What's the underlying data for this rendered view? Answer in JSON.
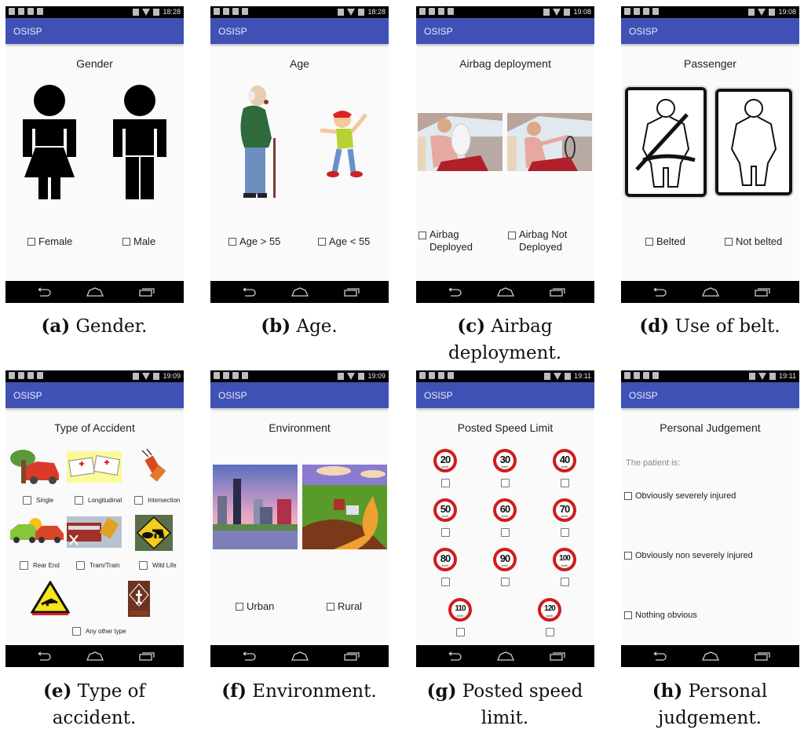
{
  "app_name": "OSISP",
  "colors": {
    "toolbar": "#3f51b5",
    "statusbar": "#000000",
    "background": "#fafafa",
    "speed_sign_red": "#d01c1c"
  },
  "panels": [
    {
      "id": "a",
      "status_time": "18:28",
      "title": "Gender",
      "images": [
        "female-figure-icon",
        "male-figure-icon"
      ],
      "options": [
        "Female",
        "Male"
      ],
      "caption_letter": "(a)",
      "caption_text": "Gender."
    },
    {
      "id": "b",
      "status_time": "18:28",
      "title": "Age",
      "images": [
        "old-man-cartoon",
        "young-boy-cartoon"
      ],
      "options": [
        "Age > 55",
        "Age < 55"
      ],
      "caption_letter": "(b)",
      "caption_text": "Age."
    },
    {
      "id": "c",
      "status_time": "19:08",
      "title": "Airbag deployment",
      "images": [
        "airbag-deployed-illustration",
        "airbag-not-deployed-illustration"
      ],
      "options": [
        "Airbag Deployed",
        "Airbag Not Deployed"
      ],
      "caption_letter": "(c)",
      "caption_text": "Airbag deployment."
    },
    {
      "id": "d",
      "status_time": "19:08",
      "title": "Passenger",
      "images": [
        "belted-passenger-sign",
        "not-belted-passenger-sign"
      ],
      "options": [
        "Belted",
        "Not belted"
      ],
      "caption_letter": "(d)",
      "caption_text": "Use of belt."
    },
    {
      "id": "e",
      "status_time": "19:09",
      "title": "Type of Accident",
      "options": [
        "Single",
        "Longitudinal",
        "Intersection",
        "Rear End",
        "Tram/Train",
        "Wild Life",
        "Any other type"
      ],
      "caption_letter": "(e)",
      "caption_text": "Type of accident."
    },
    {
      "id": "f",
      "status_time": "19:09",
      "title": "Environment",
      "images": [
        "urban-city-painting",
        "rural-countryside-painting"
      ],
      "options": [
        "Urban",
        "Rural"
      ],
      "caption_letter": "(f)",
      "caption_text": "Environment."
    },
    {
      "id": "g",
      "status_time": "19:11",
      "title": "Posted Speed Limit",
      "speed_unit": "km/h",
      "speeds": [
        "20",
        "30",
        "40",
        "50",
        "60",
        "70",
        "80",
        "90",
        "100",
        "110",
        "120"
      ],
      "caption_letter": "(g)",
      "caption_text": "Posted speed limit."
    },
    {
      "id": "h",
      "status_time": "19:11",
      "title": "Personal Judgement",
      "prompt": "The patient is:",
      "options": [
        "Obviously severely injured",
        "Obviously non severely injured",
        "Nothing obvious"
      ],
      "caption_letter": "(h)",
      "caption_text": "Personal judgement."
    }
  ]
}
